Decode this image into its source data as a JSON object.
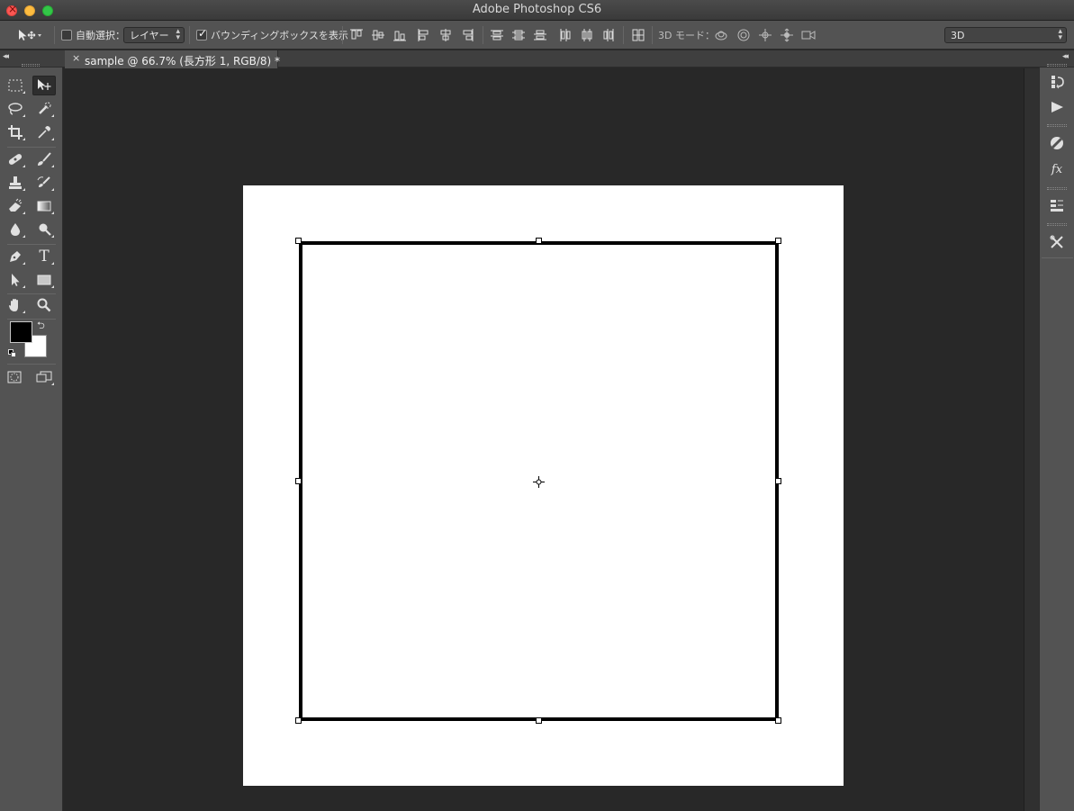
{
  "window": {
    "title": "Adobe Photoshop CS6"
  },
  "options_bar": {
    "auto_select_label": "自動選択：",
    "auto_select_checked": false,
    "auto_select_target": "レイヤー",
    "bounding_box_label": "バウンディングボックスを表示",
    "bounding_box_checked": true,
    "mode_3d_label": "3D モード：",
    "workspace": "3D"
  },
  "document_tab": {
    "close_glyph": "×",
    "label": "sample @ 66.7% (長方形 1, RGB/8) *"
  },
  "tools": [
    {
      "name": "rectangular-marquee-tool",
      "icon": "marquee-icon"
    },
    {
      "name": "move-tool",
      "icon": "move-icon",
      "active": true
    },
    {
      "name": "lasso-tool",
      "icon": "lasso-icon"
    },
    {
      "name": "quick-selection-tool",
      "icon": "quick-selection-icon"
    },
    {
      "name": "crop-tool",
      "icon": "crop-icon"
    },
    {
      "name": "eyedropper-tool",
      "icon": "eyedropper-icon"
    },
    {
      "name": "spot-healing-tool",
      "icon": "bandage-icon"
    },
    {
      "name": "brush-tool",
      "icon": "brush-icon"
    },
    {
      "name": "clone-stamp-tool",
      "icon": "stamp-icon"
    },
    {
      "name": "history-brush-tool",
      "icon": "history-brush-icon"
    },
    {
      "name": "eraser-tool",
      "icon": "eraser-icon"
    },
    {
      "name": "gradient-tool",
      "icon": "gradient-icon"
    },
    {
      "name": "blur-tool",
      "icon": "drop-icon"
    },
    {
      "name": "dodge-tool",
      "icon": "dodge-icon"
    },
    {
      "name": "pen-tool",
      "icon": "pen-icon"
    },
    {
      "name": "type-tool",
      "icon": "type-icon",
      "glyph": "T"
    },
    {
      "name": "path-selection-tool",
      "icon": "arrow-icon"
    },
    {
      "name": "rectangle-tool",
      "icon": "rectangle-icon"
    },
    {
      "name": "hand-tool",
      "icon": "hand-icon"
    },
    {
      "name": "zoom-tool",
      "icon": "magnifier-icon"
    }
  ],
  "colors": {
    "foreground": "#000000",
    "background": "#ffffff",
    "ui_panel": "#535353",
    "canvas_bg": "#282828"
  },
  "right_dock": [
    {
      "name": "history-panel",
      "icon": "history-icon"
    },
    {
      "name": "actions-panel",
      "icon": "play-icon"
    },
    {
      "name": "adjustments-panel",
      "icon": "adjustment-icon"
    },
    {
      "name": "styles-panel",
      "icon": "fx-icon",
      "glyph": "fx"
    },
    {
      "name": "layers-panel",
      "icon": "layers-icon"
    },
    {
      "name": "tool-presets-panel",
      "icon": "tools-icon"
    }
  ]
}
